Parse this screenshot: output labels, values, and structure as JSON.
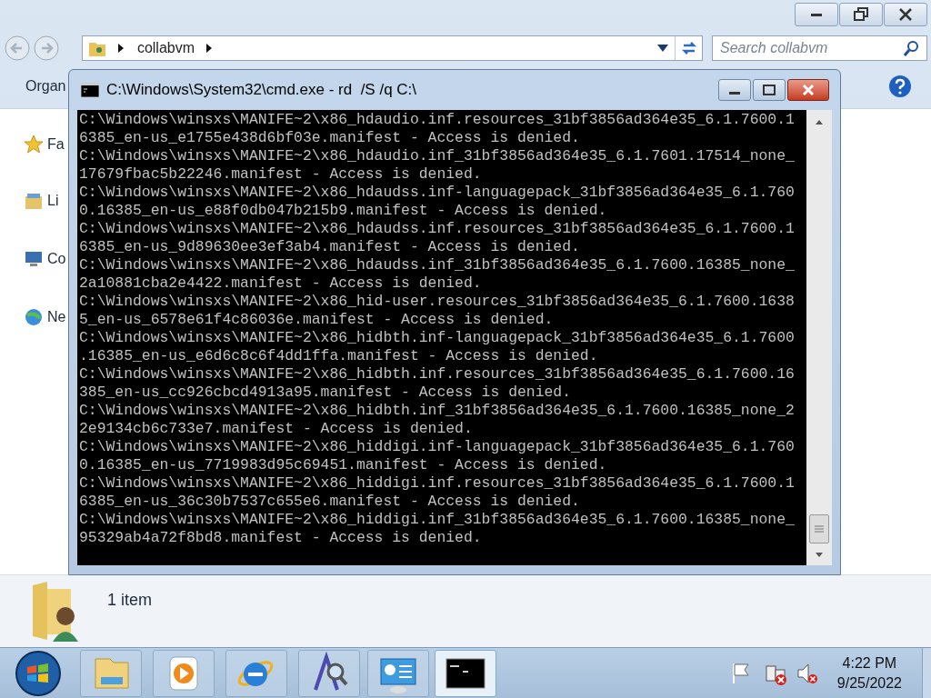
{
  "explorer": {
    "address": {
      "crumbs": [
        "collabvm"
      ]
    },
    "search": {
      "placeholder": "Search collabvm"
    },
    "toolbar": {
      "organize": "Organ"
    },
    "sidebar": {
      "items": [
        {
          "label": "Fa",
          "kind": "favorites"
        },
        {
          "label": "Li",
          "kind": "libraries"
        },
        {
          "label": "Co",
          "kind": "computer"
        },
        {
          "label": "Ne",
          "kind": "network"
        }
      ]
    },
    "details": {
      "summary": "1 item"
    }
  },
  "console": {
    "title": "C:\\Windows\\System32\\cmd.exe - rd  /S /q C:\\",
    "lines": [
      "C:\\Windows\\winsxs\\MANIFE~2\\x86_hdaudio.inf.resources_31bf3856ad364e35_6.1.7600.1",
      "6385_en-us_e1755e438d6bf03e.manifest - Access is denied.",
      "C:\\Windows\\winsxs\\MANIFE~2\\x86_hdaudio.inf_31bf3856ad364e35_6.1.7601.17514_none_",
      "17679fbac5b22246.manifest - Access is denied.",
      "C:\\Windows\\winsxs\\MANIFE~2\\x86_hdaudss.inf-languagepack_31bf3856ad364e35_6.1.760",
      "0.16385_en-us_e88f0db047b215b9.manifest - Access is denied.",
      "C:\\Windows\\winsxs\\MANIFE~2\\x86_hdaudss.inf.resources_31bf3856ad364e35_6.1.7600.1",
      "6385_en-us_9d89630ee3ef3ab4.manifest - Access is denied.",
      "C:\\Windows\\winsxs\\MANIFE~2\\x86_hdaudss.inf_31bf3856ad364e35_6.1.7600.16385_none_",
      "2a10881cba2e4422.manifest - Access is denied.",
      "C:\\Windows\\winsxs\\MANIFE~2\\x86_hid-user.resources_31bf3856ad364e35_6.1.7600.1638",
      "5_en-us_6578e61f4c86036e.manifest - Access is denied.",
      "C:\\Windows\\winsxs\\MANIFE~2\\x86_hidbth.inf-languagepack_31bf3856ad364e35_6.1.7600",
      ".16385_en-us_e6d6c8c6f4dd1ffa.manifest - Access is denied.",
      "C:\\Windows\\winsxs\\MANIFE~2\\x86_hidbth.inf.resources_31bf3856ad364e35_6.1.7600.16",
      "385_en-us_cc926cbcd4913a95.manifest - Access is denied.",
      "C:\\Windows\\winsxs\\MANIFE~2\\x86_hidbth.inf_31bf3856ad364e35_6.1.7600.16385_none_2",
      "2e9134cb6c733e7.manifest - Access is denied.",
      "C:\\Windows\\winsxs\\MANIFE~2\\x86_hiddigi.inf-languagepack_31bf3856ad364e35_6.1.760",
      "0.16385_en-us_7719983d95c69451.manifest - Access is denied.",
      "C:\\Windows\\winsxs\\MANIFE~2\\x86_hiddigi.inf.resources_31bf3856ad364e35_6.1.7600.1",
      "6385_en-us_36c30b7537c655e6.manifest - Access is denied.",
      "C:\\Windows\\winsxs\\MANIFE~2\\x86_hiddigi.inf_31bf3856ad364e35_6.1.7600.16385_none_",
      "95329ab4a72f8bd8.manifest - Access is denied."
    ]
  },
  "taskbar": {
    "buttons": [
      {
        "kind": "explorer",
        "active": false
      },
      {
        "kind": "media",
        "active": false
      },
      {
        "kind": "browser",
        "active": false
      },
      {
        "kind": "search",
        "active": false
      },
      {
        "kind": "panel",
        "active": false
      },
      {
        "kind": "console",
        "active": true
      }
    ],
    "clock": {
      "time": "4:22 PM",
      "date": "9/25/2022"
    }
  }
}
